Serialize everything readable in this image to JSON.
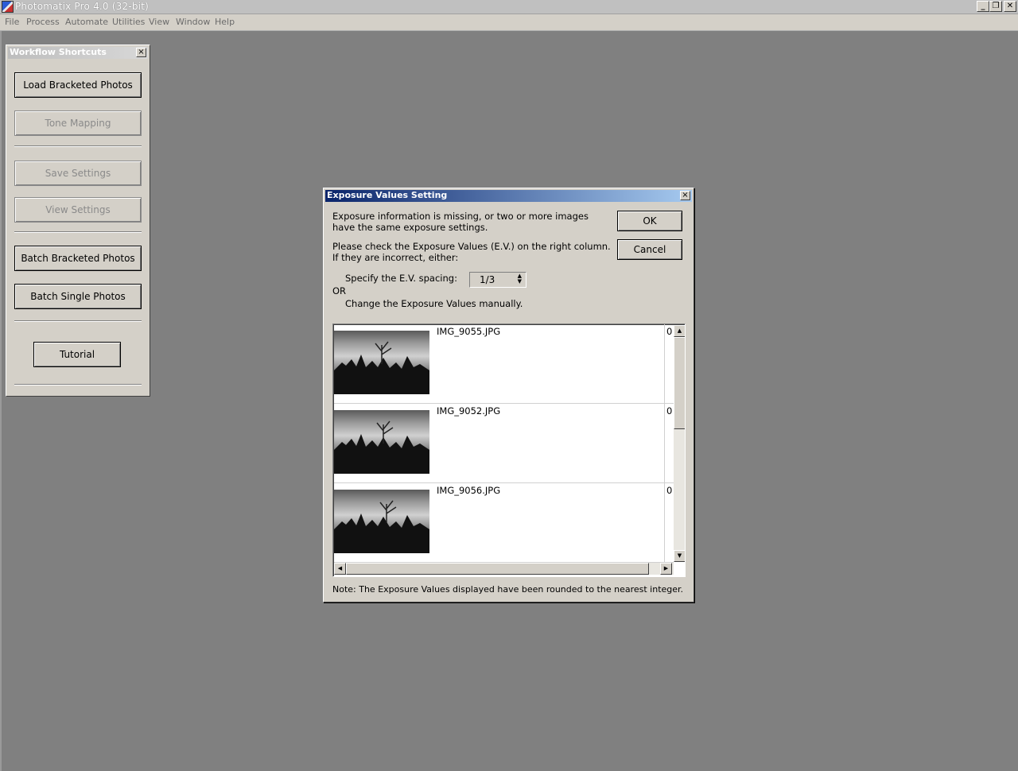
{
  "window": {
    "title": "Photomatix Pro 4.0 (32-bit)",
    "minimize": "_",
    "restore": "❐",
    "close": "✕"
  },
  "menu": [
    "File",
    "Process",
    "Automate",
    "Utilities",
    "View",
    "Window",
    "Help"
  ],
  "panel": {
    "title": "Workflow Shortcuts",
    "close": "×",
    "buttons": [
      {
        "label": "Load Bracketed Photos",
        "enabled": true
      },
      {
        "label": "Tone Mapping",
        "enabled": false
      },
      {
        "label": "Save Settings",
        "enabled": false
      },
      {
        "label": "View Settings",
        "enabled": false
      },
      {
        "label": "Batch Bracketed Photos",
        "enabled": true
      },
      {
        "label": "Batch Single Photos",
        "enabled": true
      },
      {
        "label": "Tutorial",
        "enabled": true
      }
    ]
  },
  "dialog": {
    "title": "Exposure Values Setting",
    "close": "×",
    "message1_line1": "Exposure information is missing, or two or more images",
    "message1_line2": "have the same exposure settings.",
    "message2_line1": "Please check the Exposure Values (E.V.) on the right column.",
    "message2_line2": "If they are incorrect, either:",
    "spacing_label": "Specify the E.V. spacing:",
    "spacing_value": "1/3",
    "or_label": "OR",
    "manual_label": "Change the Exposure Values manually.",
    "ok_label": "OK",
    "cancel_label": "Cancel",
    "files": [
      {
        "name": "IMG_9055.JPG",
        "ev": "0"
      },
      {
        "name": "IMG_9052.JPG",
        "ev": "0"
      },
      {
        "name": "IMG_9056.JPG",
        "ev": "0"
      }
    ],
    "note": "Note: The Exposure Values displayed have been rounded to the nearest integer."
  }
}
